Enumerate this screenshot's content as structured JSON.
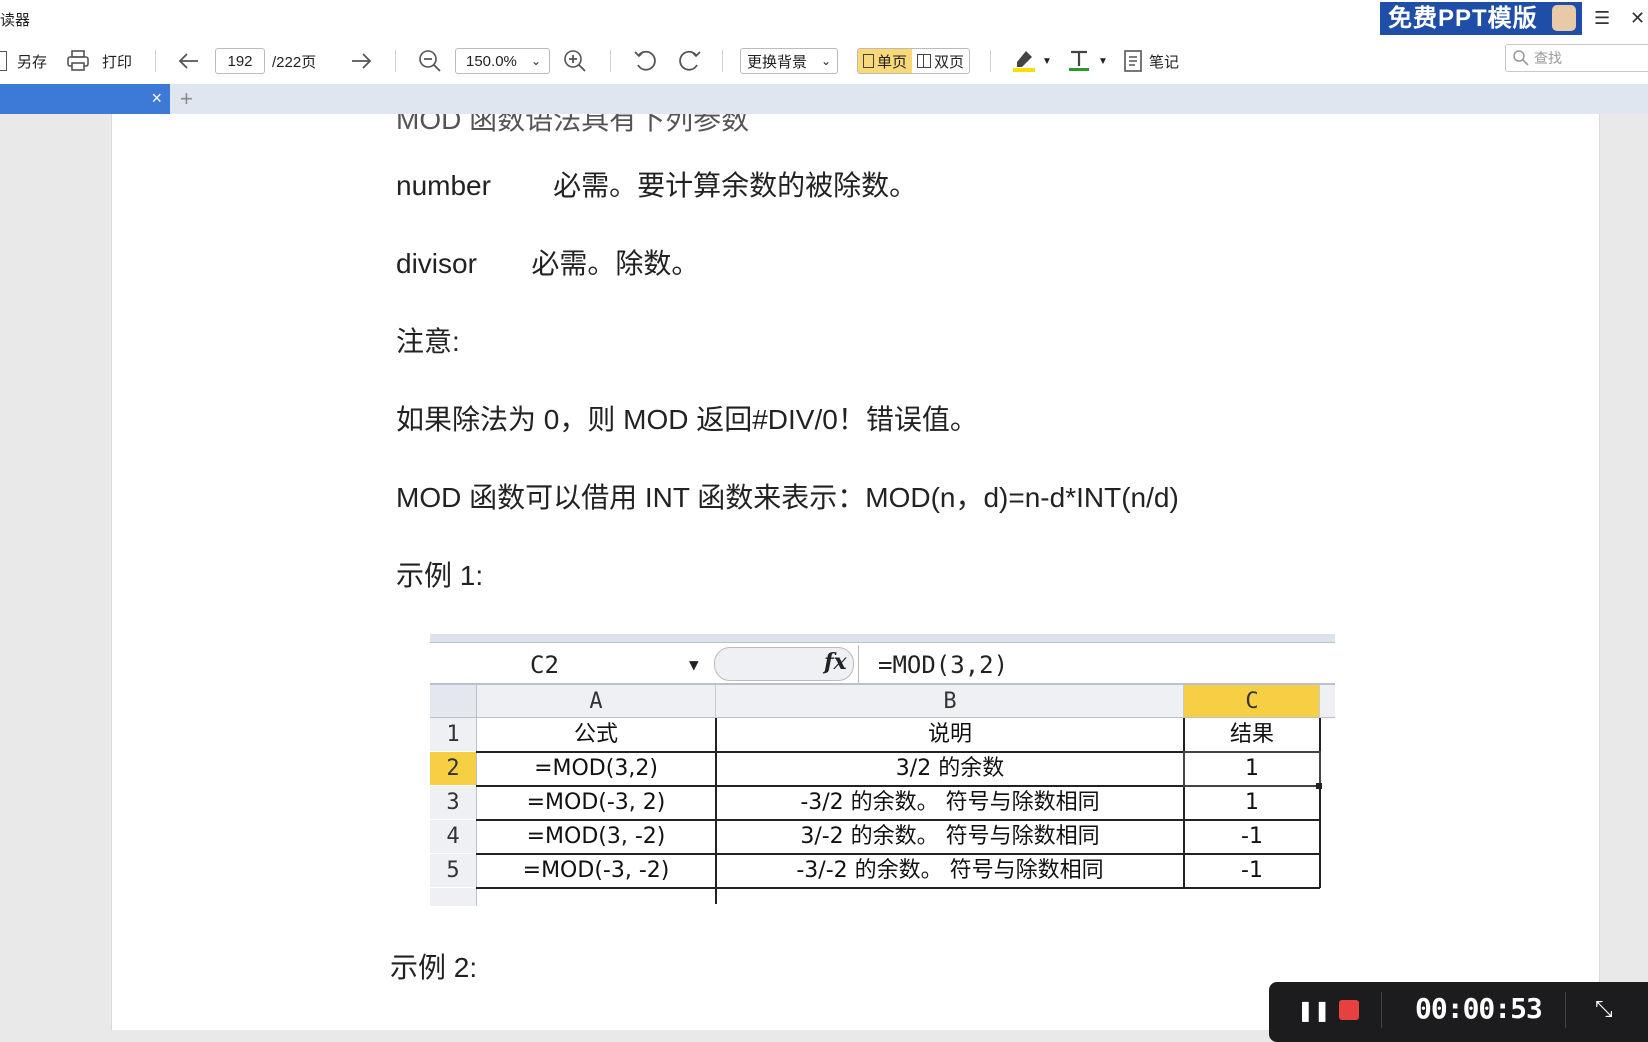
{
  "window": {
    "title_fragment": "读器",
    "ad_banner": "免费PPT模版",
    "menu_icon": "hamburger-icon",
    "close_icon": "close-icon"
  },
  "toolbar": {
    "save_as": "另存",
    "print": "打印",
    "current_page": "192",
    "total_pages": "/222页",
    "zoom": "150.0%",
    "background": "更换背景",
    "single_page": "单页",
    "double_page": "双页",
    "notes": "笔记",
    "search_placeholder": "查找",
    "highlight_color": "#f5e000",
    "text_color": "#2a9a2a"
  },
  "tabs": {
    "active_close": "×",
    "add": "+"
  },
  "document": {
    "partial_line": "MOD 函数语法具有下列参数",
    "lines": [
      "number        必需。要计算余数的被除数。",
      "divisor       必需。除数。",
      "注意:",
      "如果除法为 0，则 MOD 返回#DIV/0！错误值。",
      "MOD 函数可以借用 INT 函数来表示：MOD(n，d)=n-d*INT(n/d)",
      "示例 1:",
      "示例 2:"
    ]
  },
  "spreadsheet": {
    "name_box": "C2",
    "fx_label": "fx",
    "formula": "=MOD(3,2)",
    "columns": [
      "A",
      "B",
      "C"
    ],
    "rows": [
      {
        "num": "1",
        "cells": [
          "公式",
          "说明",
          "结果"
        ]
      },
      {
        "num": "2",
        "cells": [
          "=MOD(3,2)",
          "3/2 的余数",
          "1"
        ]
      },
      {
        "num": "3",
        "cells": [
          "=MOD(-3, 2)",
          "-3/2 的余数。 符号与除数相同",
          "1"
        ]
      },
      {
        "num": "4",
        "cells": [
          "=MOD(3, -2)",
          "3/-2 的余数。 符号与除数相同",
          "-1"
        ]
      },
      {
        "num": "5",
        "cells": [
          "=MOD(-3, -2)",
          "-3/-2 的余数。 符号与除数相同",
          "-1"
        ]
      }
    ]
  },
  "recorder": {
    "time": "00:00:53"
  }
}
